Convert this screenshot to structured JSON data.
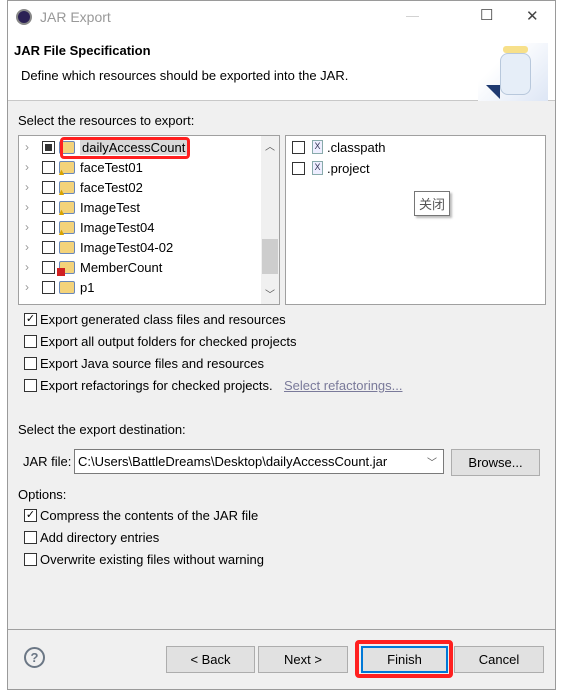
{
  "window": {
    "title": "JAR Export",
    "minimize": "—",
    "maximize": "☐",
    "close": "✕"
  },
  "header": {
    "title": "JAR File Specification",
    "description": "Define which resources should be exported into the JAR."
  },
  "resources": {
    "label": "Select the resources to export:",
    "projects": [
      {
        "name": "dailyAccessCount",
        "state": "partial",
        "warning": false,
        "error": false,
        "selected": true
      },
      {
        "name": "faceTest01",
        "state": "unchecked",
        "warning": true
      },
      {
        "name": "faceTest02",
        "state": "unchecked",
        "warning": true
      },
      {
        "name": "ImageTest",
        "state": "unchecked",
        "warning": true
      },
      {
        "name": "ImageTest04",
        "state": "unchecked",
        "warning": true
      },
      {
        "name": "ImageTest04-02",
        "state": "unchecked",
        "warning": false
      },
      {
        "name": "MemberCount",
        "state": "unchecked",
        "error": true
      },
      {
        "name": "p1",
        "state": "unchecked"
      }
    ],
    "files": [
      {
        "name": ".classpath",
        "checked": false
      },
      {
        "name": ".project",
        "checked": false
      }
    ],
    "tooltip": "关闭"
  },
  "export_options": [
    {
      "label": "Export generated class files and resources",
      "checked": true
    },
    {
      "label": "Export all output folders for checked projects",
      "checked": false
    },
    {
      "label": "Export Java source files and resources",
      "checked": false
    },
    {
      "label": "Export refactorings for checked projects.",
      "checked": false
    }
  ],
  "select_refactorings": "Select refactorings...",
  "destination": {
    "label": "Select the export destination:",
    "jar_label": "JAR file:",
    "jar_value": "C:\\Users\\BattleDreams\\Desktop\\dailyAccessCount.jar",
    "browse": "Browse..."
  },
  "options": {
    "label": "Options:",
    "items": [
      {
        "label": "Compress the contents of the JAR file",
        "checked": true
      },
      {
        "label": "Add directory entries",
        "checked": false
      },
      {
        "label": "Overwrite existing files without warning",
        "checked": false
      }
    ]
  },
  "buttons": {
    "help": "?",
    "back": "< Back",
    "next": "Next >",
    "finish": "Finish",
    "cancel": "Cancel"
  },
  "colors": {
    "highlight": "#ff2020",
    "link": "#7a7a9a",
    "finish_border": "#0078d7"
  }
}
